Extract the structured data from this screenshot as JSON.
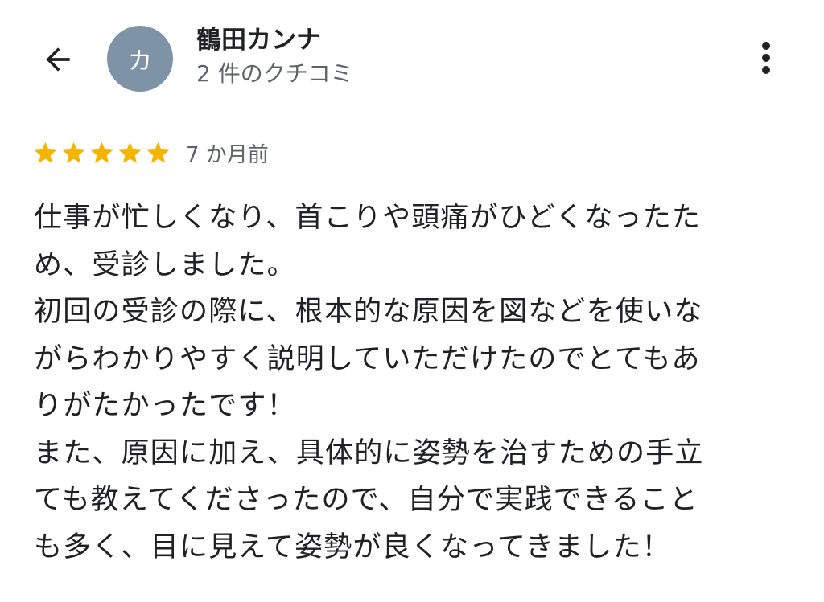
{
  "header": {
    "back_icon": "arrow-left-icon",
    "avatar_letter": "カ",
    "avatar_color": "#7f93a6",
    "user_name": "鶴田カンナ",
    "review_count": "2 件のクチコミ",
    "more_icon": "more-vertical-icon"
  },
  "review": {
    "rating": 5,
    "max_rating": 5,
    "star_color": "#f4b400",
    "time_ago": "7 か月前",
    "lines": [
      "仕事が忙しくなり、首こりや頭痛がひどくなったた",
      "め、受診しました。",
      "初回の受診の際に、根本的な原因を図などを使いな",
      "がらわかりやすく説明していただけたのでとてもあ",
      "りがたかったです！",
      "また、原因に加え、具体的に姿勢を治すための手立",
      "ても教えてくださったので、自分で実践できること",
      "も多く、目に見えて姿勢が良くなってきました！"
    ]
  }
}
